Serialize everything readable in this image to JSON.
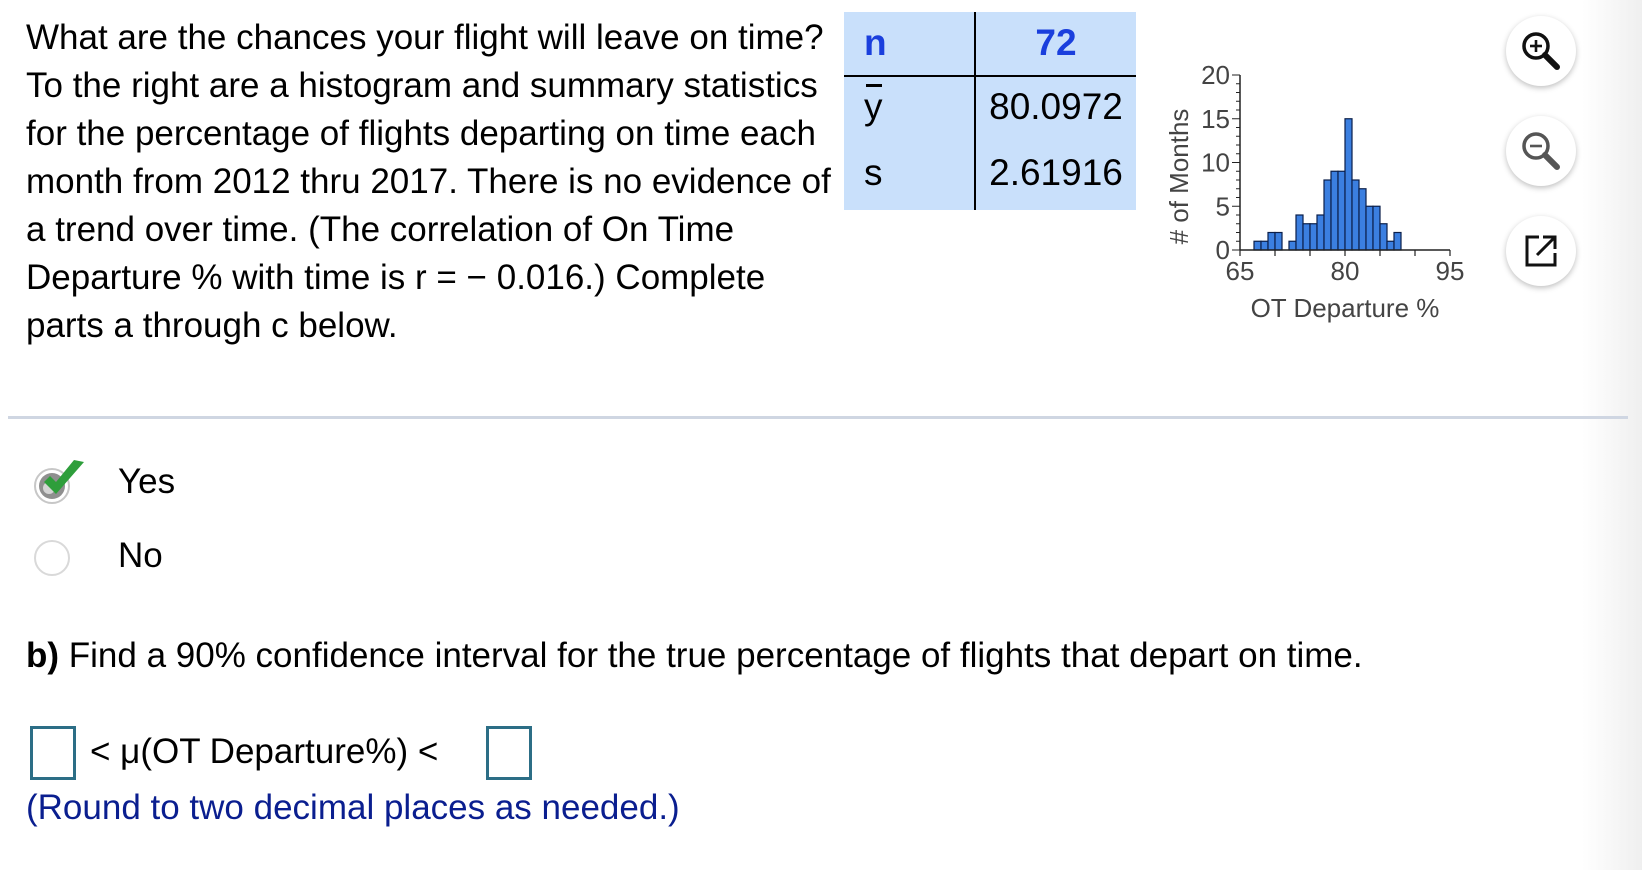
{
  "problem": {
    "text": "What are the chances your flight will leave on time? To the right are a histogram and summary statistics for the percentage of flights departing on time each month from 2012 thru 2017. There is no evidence of a trend over time. (The correlation of On Time Departure % with time is r = − 0.016.) Complete parts a through c below."
  },
  "stats_table": {
    "n_label": "n",
    "n_value": "72",
    "ybar_label": "y",
    "ybar_value": "80.0972",
    "s_label": "s",
    "s_value": "2.61916"
  },
  "chart_data": {
    "type": "bar",
    "xlabel": "OT Departure %",
    "ylabel": "# of Months",
    "xlim": [
      65,
      95
    ],
    "ylim": [
      0,
      20
    ],
    "xticks": [
      "65",
      "80",
      "95"
    ],
    "yticks": [
      "0",
      "5",
      "10",
      "15",
      "20"
    ],
    "bin_width": 1,
    "bins": [
      {
        "x": 67,
        "count": 1
      },
      {
        "x": 68,
        "count": 1
      },
      {
        "x": 69,
        "count": 2
      },
      {
        "x": 70,
        "count": 2
      },
      {
        "x": 71,
        "count": 0
      },
      {
        "x": 72,
        "count": 1
      },
      {
        "x": 73,
        "count": 4
      },
      {
        "x": 74,
        "count": 3
      },
      {
        "x": 75,
        "count": 3
      },
      {
        "x": 76,
        "count": 4
      },
      {
        "x": 77,
        "count": 8
      },
      {
        "x": 78,
        "count": 9
      },
      {
        "x": 79,
        "count": 9
      },
      {
        "x": 80,
        "count": 15
      },
      {
        "x": 81,
        "count": 8
      },
      {
        "x": 82,
        "count": 7
      },
      {
        "x": 83,
        "count": 5
      },
      {
        "x": 84,
        "count": 5
      },
      {
        "x": 85,
        "count": 3
      },
      {
        "x": 86,
        "count": 1
      },
      {
        "x": 87,
        "count": 2
      }
    ],
    "bar_color": "#3b7fe0"
  },
  "toolbar": {
    "zoom_in_icon": "zoom-in-icon",
    "zoom_out_icon": "zoom-out-icon",
    "popout_icon": "external-link-icon"
  },
  "part_a": {
    "options": [
      {
        "label": "Yes",
        "selected": true
      },
      {
        "label": "No",
        "selected": false
      }
    ]
  },
  "part_b": {
    "prefix": "b)",
    "question": "Find a 90% confidence interval for the true percentage of flights that depart on time.",
    "interval_text": "< μ(OT Departure%) <",
    "hint": "(Round to two decimal places as needed.)"
  },
  "colors": {
    "accent_blue": "#1a3fdd",
    "table_bg": "#c9e0fb",
    "check_green": "#2e9e3b",
    "hint_text": "#0a1e8f"
  }
}
